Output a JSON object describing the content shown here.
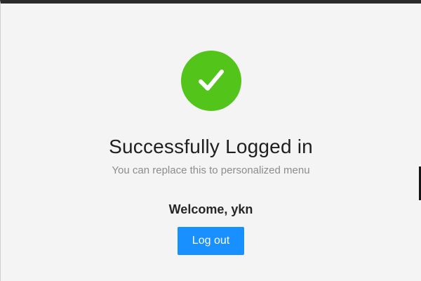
{
  "result": {
    "icon": "check-circle-icon",
    "status": "success",
    "title": "Successfully Logged in",
    "subtitle": "You can replace this to personalized menu",
    "welcome": "Welcome, ykn",
    "logout_label": "Log out"
  },
  "colors": {
    "success": "#52c41a",
    "primary": "#1890ff",
    "background": "#f4f4f4",
    "title_text": "#1f1f1f",
    "subtitle_text": "#8c8c8c"
  }
}
